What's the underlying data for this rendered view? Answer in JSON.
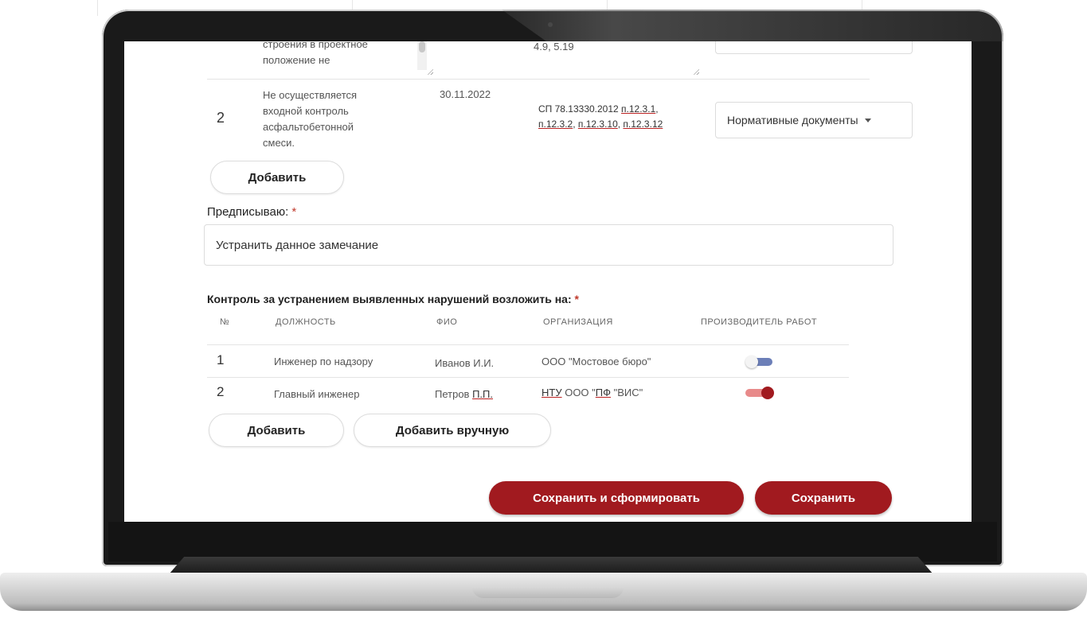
{
  "violations": {
    "row1": {
      "description_partial": "строения в проектное\nположение не",
      "norms_partial": "4.9, 5.19"
    },
    "row2": {
      "number": "2",
      "description": "Не осуществляется\nвходной контроль\nасфальтобетонной\nсмеси.",
      "date": "30.11.2022",
      "norms_prefix": "СП 78.13330.2012 ",
      "norms_link1": "п.12.3.1",
      "norms_sep1": ",",
      "norms_link2": "п.12.3.2",
      "norms_sep2": ", ",
      "norms_link3": "п.12.3.10",
      "norms_sep3": ", ",
      "norms_link4": "п.12.3.12",
      "select_label": "Нормативные документы"
    },
    "add_label": "Добавить"
  },
  "prescribe": {
    "label": "Предписываю:",
    "required_mark": "*",
    "value": "Устранить данное замечание"
  },
  "control": {
    "label": "Контроль за устранением выявленных нарушений возложить на:",
    "required_mark": "*",
    "headers": {
      "num": "№",
      "position": "ДОЛЖНОСТЬ",
      "name": "ФИО",
      "org": "ОРГАНИЗАЦИЯ",
      "producer": "ПРОИЗВОДИТЕЛЬ РАБОТ"
    },
    "rows": [
      {
        "num": "1",
        "position": "Инженер по надзору",
        "name": "Иванов И.И.",
        "org": "ООО \"Мостовое бюро\"",
        "producer": false
      },
      {
        "num": "2",
        "position": "Главный инженер",
        "name_prefix": "Петров ",
        "name_link": "П.П.",
        "org_link1": "НТУ",
        "org_mid": " ООО \"",
        "org_link2": "ПФ",
        "org_suffix": " \"ВИС\"",
        "producer": true
      }
    ],
    "add_label": "Добавить",
    "add_manual_label": "Добавить вручную"
  },
  "actions": {
    "save_and_generate": "Сохранить и сформировать",
    "save": "Сохранить"
  },
  "colors": {
    "accent": "#a11a1f",
    "toggle_on_track": "#e88a8a",
    "toggle_off_track": "#6c7fb8"
  }
}
